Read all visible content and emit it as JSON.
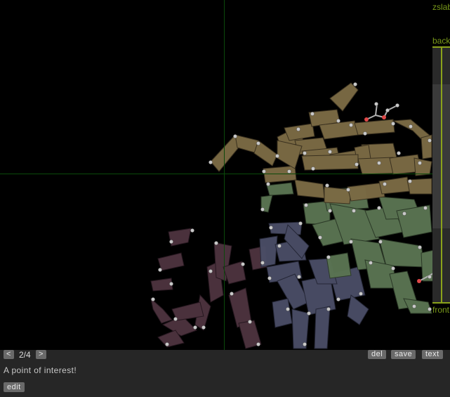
{
  "viewer": {
    "molecule_canvas_label": "3D molecular ribbon view"
  },
  "zslab": {
    "title": "zslab",
    "back_label": "back",
    "front_label": "front"
  },
  "controls": {
    "prev_label": "<",
    "page_indicator": "2/4",
    "next_label": ">",
    "del_label": "del",
    "save_label": "save",
    "text_label": "text",
    "edit_label": "edit"
  },
  "annotation": {
    "text": "A point of interest!"
  },
  "colors": {
    "chain_tan": "#7a6a44",
    "chain_green": "#5a7452",
    "chain_slate": "#4a4d66",
    "chain_mauve": "#4e3440",
    "atom": "#c8c8c8",
    "oxygen": "#e04848",
    "crosshair": "#0b4a0b",
    "zslab_accent": "#8aa21a",
    "button_bg": "#6a6a6a",
    "bar_bg": "#262626"
  }
}
